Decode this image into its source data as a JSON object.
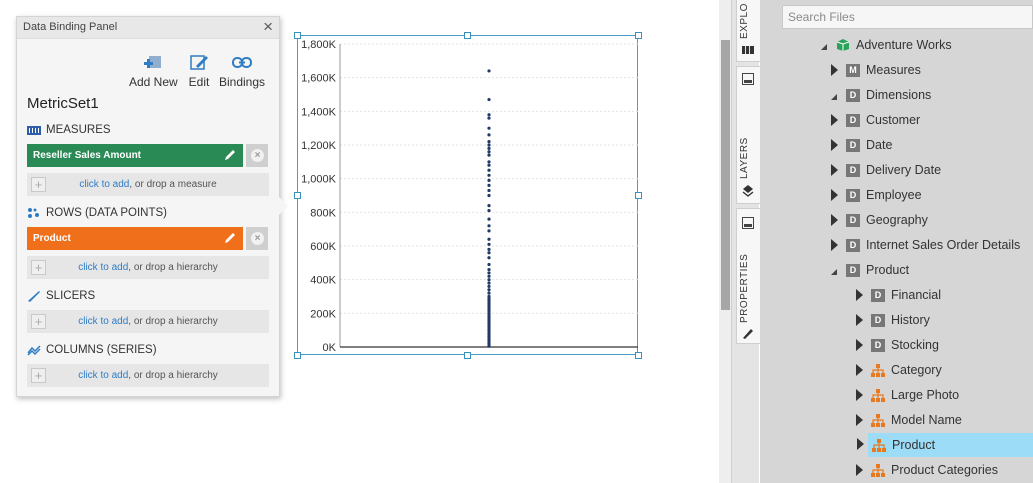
{
  "panel": {
    "title": "Data Binding Panel",
    "close_glyph": "×",
    "toolbar": {
      "add_new": "Add New",
      "edit": "Edit",
      "bindings": "Bindings"
    },
    "metricset_name": "MetricSet1",
    "measures": {
      "heading": "MEASURES",
      "field": "Reseller Sales Amount",
      "field_color": "#2a8a55",
      "drop_link": "click to add",
      "drop_text": ", or drop a measure"
    },
    "rows": {
      "heading": "ROWS (DATA POINTS)",
      "field": "Product",
      "field_color": "#ef6f1b",
      "drop_link": "click to add",
      "drop_text": ", or drop a hierarchy"
    },
    "slicers": {
      "heading": "SLICERS",
      "drop_link": "click to add",
      "drop_text": ", or drop a hierarchy"
    },
    "columns": {
      "heading": "COLUMNS (SERIES)",
      "drop_link": "click to add",
      "drop_text": ", or drop a hierarchy"
    }
  },
  "chart_data": {
    "type": "scatter",
    "yticks": [
      "0K",
      "200K",
      "400K",
      "600K",
      "800K",
      "1,000K",
      "1,200K",
      "1,400K",
      "1,600K",
      "1,800K"
    ],
    "ylim": [
      0,
      1800000
    ],
    "points_y": [
      1640000,
      1470000,
      1380000,
      1360000,
      1300000,
      1260000,
      1220000,
      1200000,
      1180000,
      1160000,
      1140000,
      1100000,
      1080000,
      1050000,
      1020000,
      990000,
      960000,
      930000,
      900000,
      840000,
      810000,
      760000,
      720000,
      690000,
      640000,
      610000,
      580000,
      560000,
      530000,
      490000,
      460000,
      440000,
      420000,
      400000,
      380000,
      360000,
      340000,
      320000,
      300000,
      280000,
      260000,
      240000,
      220000,
      200000,
      180000,
      160000,
      140000,
      120000,
      100000,
      80000,
      60000,
      40000,
      20000,
      5000
    ],
    "point_color": "#1f3a66"
  },
  "right": {
    "tabs": {
      "explore": "EXPLO",
      "layers": "LAYERS",
      "properties": "PROPERTIES"
    },
    "search_placeholder": "Search Files",
    "tree": [
      {
        "label": "Adventure Works",
        "icon": "cube-icon",
        "level": 0,
        "arrow": "expanded"
      },
      {
        "label": "Measures",
        "icon": "M",
        "level": 1,
        "arrow": "collapsed"
      },
      {
        "label": "Dimensions",
        "icon": "D",
        "level": 1,
        "arrow": "expanded"
      },
      {
        "label": "Customer",
        "icon": "D",
        "level": 2,
        "arrow": "collapsed"
      },
      {
        "label": "Date",
        "icon": "D",
        "level": 2,
        "arrow": "collapsed"
      },
      {
        "label": "Delivery Date",
        "icon": "D",
        "level": 2,
        "arrow": "collapsed"
      },
      {
        "label": "Employee",
        "icon": "D",
        "level": 2,
        "arrow": "collapsed"
      },
      {
        "label": "Geography",
        "icon": "D",
        "level": 2,
        "arrow": "collapsed"
      },
      {
        "label": "Internet Sales Order Details",
        "icon": "D",
        "level": 2,
        "arrow": "collapsed"
      },
      {
        "label": "Product",
        "icon": "D",
        "level": 2,
        "arrow": "expanded"
      },
      {
        "label": "Financial",
        "icon": "D",
        "level": 3,
        "arrow": "collapsed"
      },
      {
        "label": "History",
        "icon": "D",
        "level": 3,
        "arrow": "collapsed"
      },
      {
        "label": "Stocking",
        "icon": "D",
        "level": 3,
        "arrow": "collapsed"
      },
      {
        "label": "Category",
        "icon": "hierarchy-icon",
        "level": 3,
        "arrow": "collapsed"
      },
      {
        "label": "Large Photo",
        "icon": "hierarchy-icon",
        "level": 3,
        "arrow": "collapsed"
      },
      {
        "label": "Model Name",
        "icon": "hierarchy-icon",
        "level": 3,
        "arrow": "collapsed"
      },
      {
        "label": "Product",
        "icon": "hierarchy-icon",
        "level": 3,
        "arrow": "collapsed",
        "selected": true
      },
      {
        "label": "Product Categories",
        "icon": "hierarchy-icon",
        "level": 3,
        "arrow": "collapsed"
      }
    ]
  }
}
